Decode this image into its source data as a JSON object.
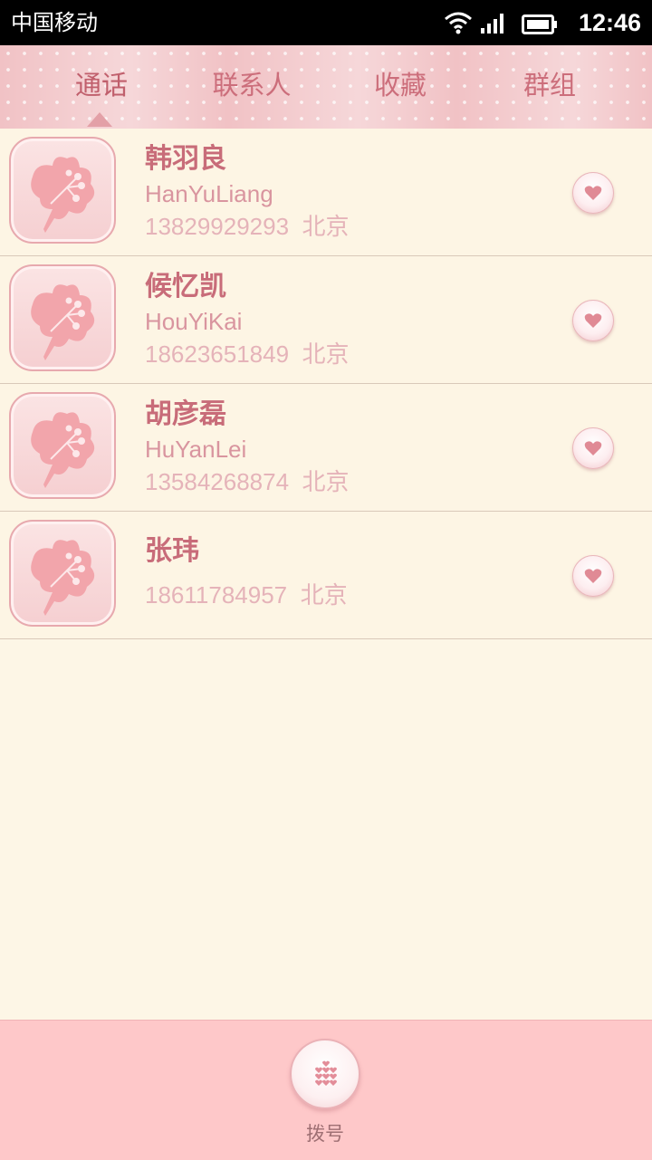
{
  "status_bar": {
    "carrier": "中国移动",
    "time": "12:46",
    "icons": [
      "wifi-icon",
      "signal-icon",
      "battery-icon"
    ]
  },
  "tabs": [
    {
      "label": "通话",
      "active": true
    },
    {
      "label": "联系人",
      "active": false
    },
    {
      "label": "收藏",
      "active": false
    },
    {
      "label": "群组",
      "active": false
    }
  ],
  "contacts": [
    {
      "name": "韩羽良",
      "pinyin": "HanYuLiang",
      "phone": "13829929293",
      "location": "北京"
    },
    {
      "name": "候忆凯",
      "pinyin": "HouYiKai",
      "phone": "18623651849",
      "location": "北京"
    },
    {
      "name": "胡彦磊",
      "pinyin": "HuYanLei",
      "phone": "13584268874",
      "location": "北京"
    },
    {
      "name": "张玮",
      "pinyin": "",
      "phone": "18611784957",
      "location": "北京"
    }
  ],
  "bottom": {
    "dial_label": "拨号",
    "dial_icon": "dialpad-hearts-icon"
  },
  "colors": {
    "accent": "#c86c79",
    "tab_bar": "#f1c2c5",
    "list_bg": "#fdf5e4",
    "bottom_bar": "#fec8c9"
  }
}
